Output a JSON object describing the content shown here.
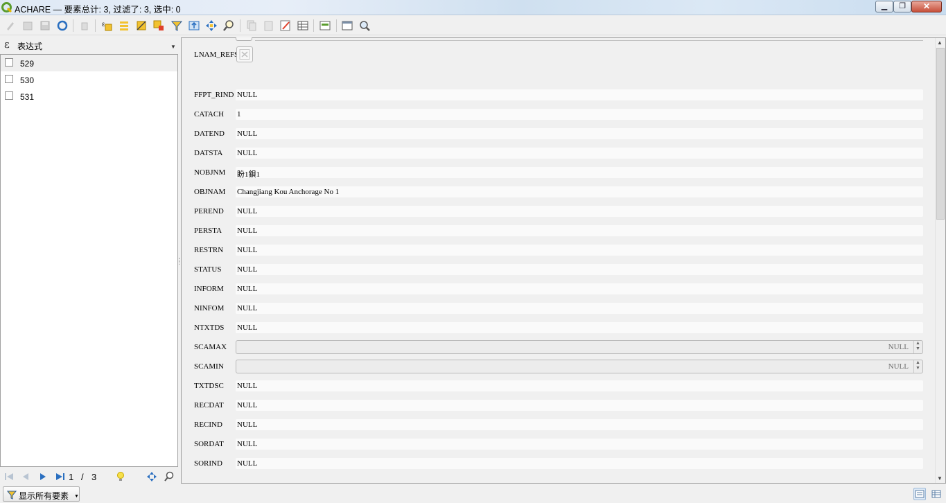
{
  "window": {
    "title": "ACHARE — 要素总计: 3, 过滤了: 3, 选中: 0",
    "min_label": "▁",
    "max_label": "❐",
    "close_label": "✕"
  },
  "toolbar": {
    "icons": [
      "edit-pencil-icon",
      "multi-edit-icon",
      "save-icon",
      "reload-icon",
      "delete-icon",
      "expression-select-icon",
      "select-all-icon",
      "invert-selection-icon",
      "deselect-icon",
      "filter-icon",
      "move-selection-top-icon",
      "pan-to-selection-icon",
      "zoom-to-selection-icon",
      "copy-icon",
      "paste-icon",
      "field-calculator-icon",
      "conditional-format-icon",
      "dock-icon",
      "table-view-icon",
      "actions-icon"
    ]
  },
  "left_panel": {
    "expression_icon": "ε",
    "expression_label": "表达式",
    "items": [
      {
        "label": "529"
      },
      {
        "label": "530"
      },
      {
        "label": "531"
      }
    ],
    "nav": {
      "current": "1",
      "separator": "/",
      "total": "3"
    }
  },
  "form": {
    "lnam_refs_label": "LNAM_REFS",
    "fields": [
      {
        "label": "FFPT_RIND",
        "value": "NULL",
        "type": "text"
      },
      {
        "label": "CATACH",
        "value": "1",
        "type": "text"
      },
      {
        "label": "DATEND",
        "value": "NULL",
        "type": "text"
      },
      {
        "label": "DATSTA",
        "value": "NULL",
        "type": "text"
      },
      {
        "label": "NOBJNM",
        "value": " 盼1鋇1",
        "type": "text"
      },
      {
        "label": "OBJNAM",
        "value": "Changjiang Kou Anchorage No 1",
        "type": "text"
      },
      {
        "label": "PEREND",
        "value": "NULL",
        "type": "text"
      },
      {
        "label": "PERSTA",
        "value": "NULL",
        "type": "text"
      },
      {
        "label": "RESTRN",
        "value": "NULL",
        "type": "text"
      },
      {
        "label": "STATUS",
        "value": "NULL",
        "type": "text"
      },
      {
        "label": "INFORM",
        "value": "NULL",
        "type": "text"
      },
      {
        "label": "NINFOM",
        "value": "NULL",
        "type": "text"
      },
      {
        "label": "NTXTDS",
        "value": "NULL",
        "type": "text"
      },
      {
        "label": "SCAMAX",
        "value": "NULL",
        "type": "spin"
      },
      {
        "label": "SCAMIN",
        "value": "NULL",
        "type": "spin"
      },
      {
        "label": "TXTDSC",
        "value": "NULL",
        "type": "text"
      },
      {
        "label": "RECDAT",
        "value": "NULL",
        "type": "text"
      },
      {
        "label": "RECIND",
        "value": "NULL",
        "type": "text"
      },
      {
        "label": "SORDAT",
        "value": "NULL",
        "type": "text"
      },
      {
        "label": "SORIND",
        "value": "NULL",
        "type": "text"
      }
    ]
  },
  "statusbar": {
    "filter_label": "显示所有要素"
  },
  "colors": {
    "accent_green": "#5a9c2e",
    "toolbar_yellow": "#e6b800",
    "form_bg": "#f0f0f0"
  }
}
